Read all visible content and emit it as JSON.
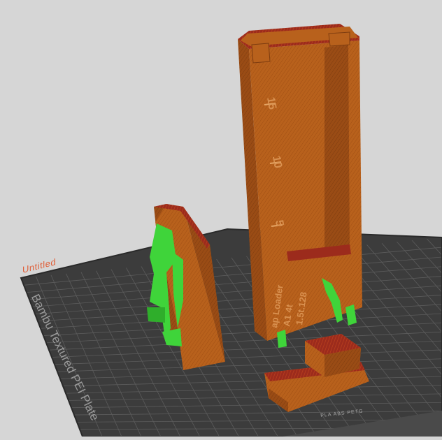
{
  "plate": {
    "label": "Untitled",
    "name": "Bambu Textured PEI Plate",
    "filaments": "PLA  ABS  PETG"
  },
  "model": {
    "ruler_marks": [
      "15",
      "10",
      "5"
    ],
    "engraving": [
      "ap Loader",
      "A1 4t",
      "1.5t.128"
    ]
  },
  "colors": {
    "background": "#d6d6d6",
    "plate": "#3c3c3c",
    "grid": "#5a5a5a",
    "model": "#b8611c",
    "model_top": "#9c2b1c",
    "support": "#3fd43a",
    "accent": "#e0603a"
  }
}
